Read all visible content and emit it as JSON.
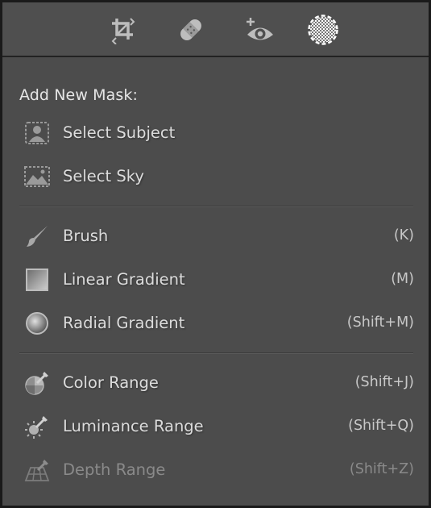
{
  "toolbar": {
    "tools": [
      {
        "icon": "crop-icon"
      },
      {
        "icon": "healing-icon"
      },
      {
        "icon": "red-eye-icon"
      },
      {
        "icon": "masking-icon"
      }
    ]
  },
  "menu": {
    "heading": "Add New Mask:",
    "items": [
      {
        "icon": "select-subject-icon",
        "label": "Select Subject",
        "shortcut": ""
      },
      {
        "icon": "select-sky-icon",
        "label": "Select Sky",
        "shortcut": ""
      },
      {
        "icon": "brush-icon",
        "label": "Brush",
        "shortcut": "(K)"
      },
      {
        "icon": "linear-gradient-icon",
        "label": "Linear Gradient",
        "shortcut": "(M)"
      },
      {
        "icon": "radial-gradient-icon",
        "label": "Radial Gradient",
        "shortcut": "(Shift+M)"
      },
      {
        "icon": "color-range-icon",
        "label": "Color Range",
        "shortcut": "(Shift+J)"
      },
      {
        "icon": "luminance-range-icon",
        "label": "Luminance Range",
        "shortcut": "(Shift+Q)"
      },
      {
        "icon": "depth-range-icon",
        "label": "Depth Range",
        "shortcut": "(Shift+Z)",
        "disabled": true
      }
    ]
  },
  "colors": {
    "panel_bg": "#4c4c4c",
    "text": "#dcdcdc",
    "disabled_text": "#8a8a8a"
  }
}
